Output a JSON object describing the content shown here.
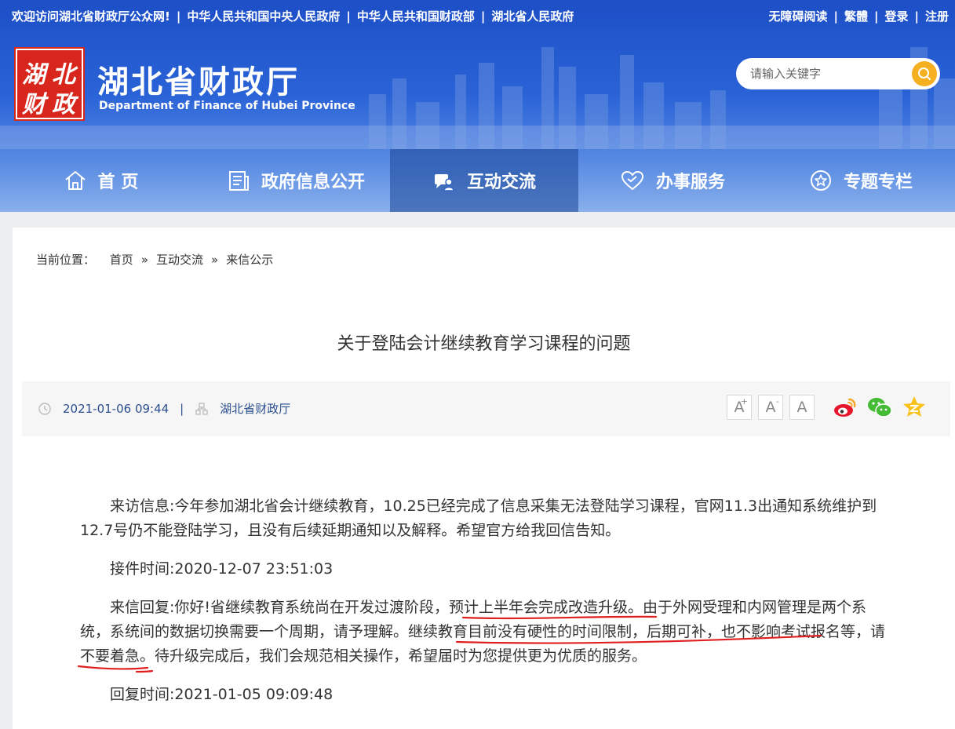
{
  "topbar": {
    "left_links": [
      "欢迎访问湖北省财政厅公众网!",
      "中华人民共和国中央人民政府",
      "中华人民共和国财政部",
      "湖北省人民政府"
    ],
    "right_links": [
      "无障碍阅读",
      "繁體",
      "登录",
      "注册"
    ]
  },
  "logo": {
    "seal_chars": [
      "湖",
      "北",
      "财",
      "政"
    ],
    "title": "湖北省财政厅",
    "subtitle": "Department of Finance of Hubei Province"
  },
  "search": {
    "placeholder": "请输入关键字"
  },
  "nav": {
    "items": [
      {
        "label": "首 页",
        "icon": "home-icon"
      },
      {
        "label": "政府信息公开",
        "icon": "document-icon"
      },
      {
        "label": "互动交流",
        "icon": "chat-icon",
        "active": true
      },
      {
        "label": "办事服务",
        "icon": "heart-icon"
      },
      {
        "label": "专题专栏",
        "icon": "star-icon"
      }
    ]
  },
  "breadcrumb": {
    "prefix": "当前位置：",
    "items": [
      "首页",
      "互动交流",
      "来信公示"
    ],
    "separator": "»"
  },
  "article": {
    "title": "关于登陆会计继续教育学习课程的问题",
    "date": "2021-01-06 09:44",
    "source": "湖北省财政厅",
    "font_buttons": [
      "A",
      "A",
      "A"
    ],
    "share_icons": [
      "weibo-icon",
      "wechat-icon",
      "qzone-icon"
    ],
    "paragraphs": {
      "p1": "来访信息:今年参加湖北省会计继续教育，10.25已经完成了信息采集无法登陆学习课程，官网11.3出通知系统维护到12.7号仍不能登陆学习，且没有后续延期通知以及解释。希望官方给我回信告知。",
      "p2": "接件时间:2020-12-07 23:51:03",
      "p3": "来信回复:你好!省继续教育系统尚在开发过渡阶段，预计上半年会完成改造升级。由于外网受理和内网管理是两个系统，系统间的数据切换需要一个周期，请予理解。继续教育目前没有硬性的时间限制，后期可补，也不影响考试报名等，请不要着急。待升级完成后，我们会规范相关操作，希望届时为您提供更为优质的服务。",
      "p4": "回复时间:2021-01-05 09:09:48"
    }
  },
  "colors": {
    "header_blue": "#2a63d7",
    "seal_red": "#d8261c",
    "search_orange": "#f5b021",
    "underline_red": "#e02020"
  }
}
